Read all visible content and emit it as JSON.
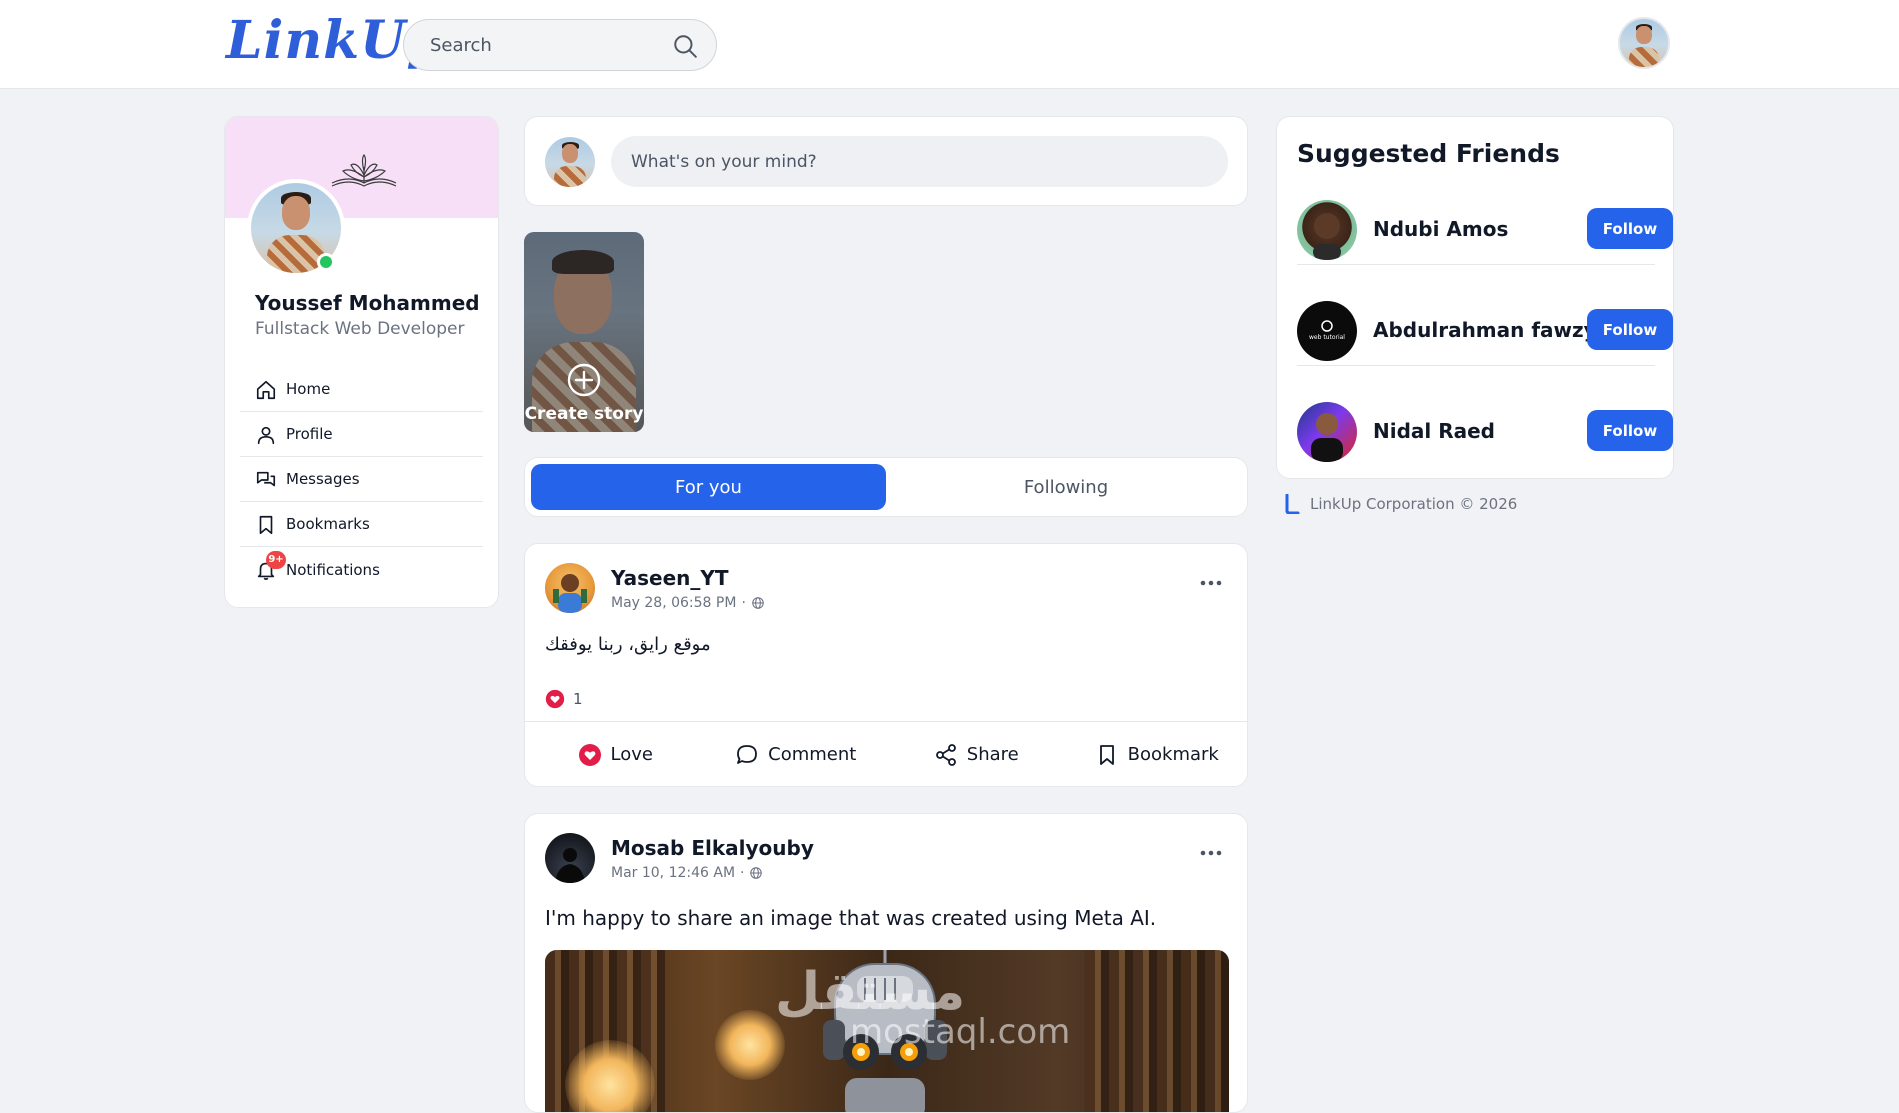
{
  "header": {
    "logo": "LinkUp",
    "search_placeholder": "Search"
  },
  "profile": {
    "name": "Youssef Mohammed",
    "title": "Fullstack Web Developer",
    "online": true
  },
  "nav": [
    {
      "label": "Home",
      "icon": "home-icon"
    },
    {
      "label": "Profile",
      "icon": "user-icon"
    },
    {
      "label": "Messages",
      "icon": "messages-icon"
    },
    {
      "label": "Bookmarks",
      "icon": "bookmark-icon"
    },
    {
      "label": "Notifications",
      "icon": "bell-icon",
      "badge": "9+"
    }
  ],
  "composer": {
    "placeholder": "What's on your mind?"
  },
  "story": {
    "label": "Create story"
  },
  "feed_tabs": [
    {
      "label": "For you",
      "active": true
    },
    {
      "label": "Following",
      "active": false
    }
  ],
  "posts": [
    {
      "author": "Yaseen_YT",
      "time": "May 28, 06:58 PM",
      "visibility": "public",
      "text": "موقع رايق، ربنا يوفقك",
      "reactions": "1",
      "actions": [
        "Love",
        "Comment",
        "Share",
        "Bookmark"
      ]
    },
    {
      "author": "Mosab Elkalyouby",
      "time": "Mar 10, 12:46 AM",
      "visibility": "public",
      "text": "I'm happy to share an image that was created using Meta AI.",
      "image_watermark": "مستقل",
      "image_watermark_url": "mostaql.com"
    }
  ],
  "suggested": {
    "title": "Suggested Friends",
    "friends": [
      {
        "name": "Ndubi Amos",
        "action": "Follow"
      },
      {
        "name": "Abdulrahman fawzy",
        "action": "Follow",
        "avatar_text": "web tutorial"
      },
      {
        "name": "Nidal Raed",
        "action": "Follow"
      }
    ]
  },
  "footer": {
    "text": "LinkUp Corporation © 2026"
  },
  "colors": {
    "accent": "#2563eb",
    "logo": "#2f5fd8",
    "love": "#e11d48",
    "online": "#22c55e",
    "badge": "#ef4444"
  }
}
